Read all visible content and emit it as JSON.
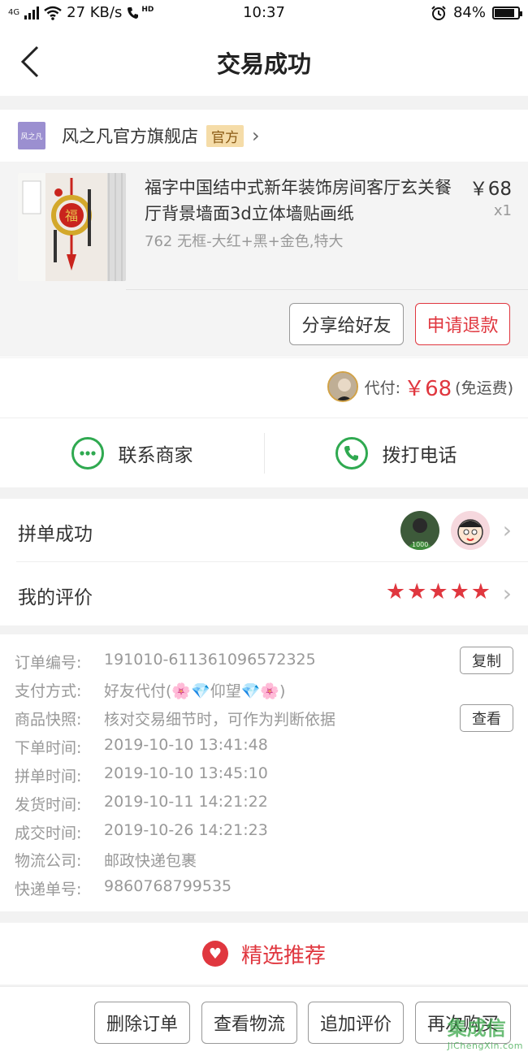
{
  "status_bar": {
    "network": "4G",
    "speed": "27 KB/s",
    "hd": "HD",
    "time": "10:37",
    "battery": "84%",
    "battery_level": 0.84
  },
  "nav": {
    "title": "交易成功"
  },
  "store": {
    "logo_text": "风之凡",
    "name": "风之凡官方旗舰店",
    "badge": "官方"
  },
  "product": {
    "name": "福字中国结中式新年装饰房间客厅玄关餐厅背景墙面3d立体墙贴画纸",
    "spec": "762 无框-大红+黑+金色,特大",
    "price": "￥68",
    "qty": "x1",
    "share_label": "分享给好友",
    "refund_label": "申请退款"
  },
  "payment": {
    "prefix": "代付:",
    "price": "￥68",
    "note": "(免运费)"
  },
  "contact": {
    "merchant_label": "联系商家",
    "call_label": "拨打电话"
  },
  "group": {
    "label": "拼单成功"
  },
  "review": {
    "label": "我的评价",
    "rating": 5,
    "star": "★"
  },
  "order": {
    "rows": [
      {
        "k": "订单编号:",
        "v": "191010-611361096572325"
      },
      {
        "k": "支付方式:",
        "v": "好友代付(🌸💎仰望💎🌸)"
      },
      {
        "k": "商品快照:",
        "v": "核对交易细节时，可作为判断依据"
      },
      {
        "k": "下单时间:",
        "v": "2019-10-10 13:41:48"
      },
      {
        "k": "拼单时间:",
        "v": "2019-10-10 13:45:10"
      },
      {
        "k": "发货时间:",
        "v": "2019-10-11 14:21:22"
      },
      {
        "k": "成交时间:",
        "v": "2019-10-26 14:21:23"
      },
      {
        "k": "物流公司:",
        "v": "邮政快递包裹"
      },
      {
        "k": "快递单号:",
        "v": "9860768799535"
      }
    ],
    "copy_label": "复制",
    "view_label": "查看"
  },
  "recommend": {
    "label": "精选推荐"
  },
  "bottom": {
    "delete_label": "删除订单",
    "logistics_label": "查看物流",
    "add_review_label": "追加评价",
    "rebuy_label": "再次购买"
  },
  "watermark": {
    "main": "集成信",
    "sub": "JiChengXin.com"
  },
  "colors": {
    "accent_red": "#e0373f",
    "green": "#2fa950",
    "official_bg": "#f5dca8"
  }
}
